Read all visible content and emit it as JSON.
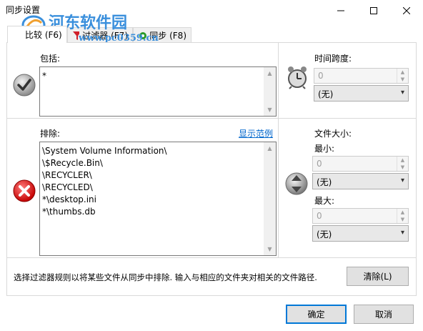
{
  "window": {
    "title": "同步设置"
  },
  "watermark": {
    "name": "河东软件园",
    "url": "www.pc0359.cn"
  },
  "tabs": [
    {
      "label": "比较 (F6)",
      "icon": "compare-icon",
      "active": true
    },
    {
      "label": "过滤器 (F7)",
      "icon": "filter-funnel-icon",
      "active": false
    },
    {
      "label": "同步 (F8)",
      "icon": "sync-gear-icon",
      "active": false
    }
  ],
  "include": {
    "label": "包括:",
    "lines": [
      "*"
    ]
  },
  "exclude": {
    "label": "排除:",
    "show_example": "显示范例",
    "lines": [
      "\\System Volume Information\\",
      "\\$Recycle.Bin\\",
      "\\RECYCLER\\",
      "\\RECYCLED\\",
      "*\\desktop.ini",
      "*\\thumbs.db"
    ]
  },
  "time_span": {
    "label": "时间跨度:",
    "value": "0",
    "unit": "(无)"
  },
  "file_size": {
    "label": "文件大小:",
    "min_label": "最小:",
    "min_value": "0",
    "min_unit": "(无)",
    "max_label": "最大:",
    "max_value": "0",
    "max_unit": "(无)"
  },
  "hint": "选择过滤器规则以将某些文件从同步中排除. 输入与相应的文件夹对相关的文件路径.",
  "buttons": {
    "clear": "清除(L)",
    "ok": "确定",
    "cancel": "取消"
  },
  "colors": {
    "accent": "#0078d7",
    "watermark": "#3a8fdc",
    "link": "#0066cc"
  }
}
